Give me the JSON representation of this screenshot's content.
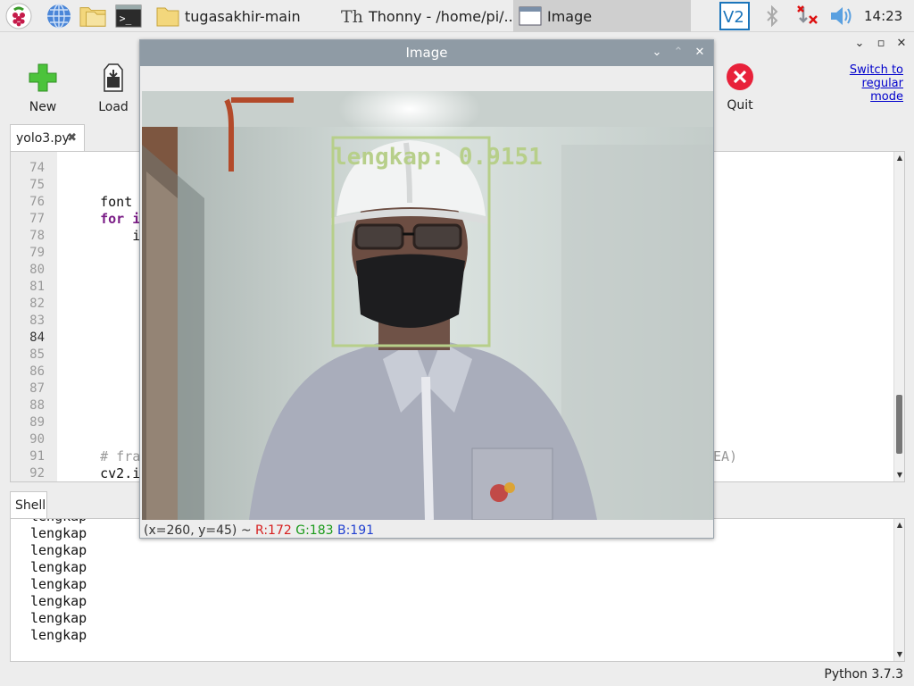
{
  "taskbar": {
    "launchers": [
      "raspberry-menu-icon",
      "web-browser-icon",
      "file-manager-icon",
      "terminal-icon"
    ],
    "tasks": [
      {
        "label": "tugasakhir-main",
        "icon": "folder-icon"
      },
      {
        "label": "Thonny  -  /home/pi/...",
        "icon": "thonny-icon"
      },
      {
        "label": "Image",
        "icon": "window-icon"
      }
    ],
    "tray": [
      "vnc-icon",
      "bluetooth-icon",
      "network-disconnected-icon",
      "volume-icon"
    ],
    "clock": "14:23"
  },
  "toolbar": {
    "new_label": "New",
    "load_label": "Load",
    "quit_label": "Quit",
    "switch_mode": "Switch to\nregular\nmode"
  },
  "editor": {
    "tab_label": "yolo3.py",
    "lines": [
      {
        "n": "74",
        "code": ""
      },
      {
        "n": "75",
        "code": ""
      },
      {
        "n": "76",
        "code": "    font"
      },
      {
        "n": "77",
        "code": "    for i"
      },
      {
        "n": "78",
        "code": "        i"
      },
      {
        "n": "79",
        "code": ""
      },
      {
        "n": "80",
        "code": ""
      },
      {
        "n": "81",
        "code": ""
      },
      {
        "n": "82",
        "code": ""
      },
      {
        "n": "83",
        "code": ""
      },
      {
        "n": "84",
        "code": ""
      },
      {
        "n": "85",
        "code": ""
      },
      {
        "n": "86",
        "code": ""
      },
      {
        "n": "87",
        "code": ""
      },
      {
        "n": "88",
        "code": ""
      },
      {
        "n": "89",
        "code": ""
      },
      {
        "n": "90",
        "code": ""
      },
      {
        "n": "91",
        "code": "    # fra"
      },
      {
        "n": "92",
        "code": "    cv2.i"
      }
    ],
    "comment_tail": "EA)"
  },
  "shell": {
    "tab_label": "Shell",
    "lines": [
      "lengkap",
      "lengkap",
      "lengkap",
      "lengkap",
      "lengkap",
      "lengkap",
      "lengkap",
      "lengkap"
    ]
  },
  "status": {
    "python_version": "Python 3.7.3"
  },
  "image_window": {
    "title": "Image",
    "detection_label": "lengkap: 0.9151",
    "pixel_info": {
      "coords": "(x=260, y=45) ~ ",
      "r": "R:172",
      "g": "G:183",
      "b": "B:191"
    },
    "colors": {
      "box": "#b7cf8a",
      "r": "#d62020",
      "g": "#1a9a1a",
      "b": "#2040d0"
    }
  }
}
